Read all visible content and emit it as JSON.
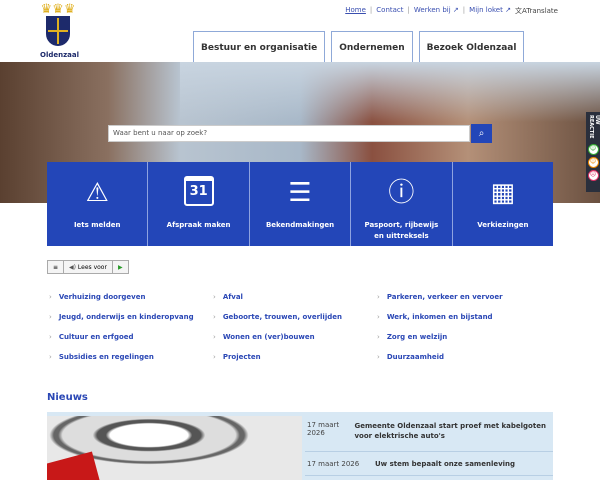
{
  "logo": {
    "name": "Oldenzaal"
  },
  "toplinks": [
    "Home",
    "Contact",
    "Werken bij",
    "Mijn loket",
    "Translate"
  ],
  "nav": [
    "Bestuur en organisatie",
    "Ondernemen",
    "Bezoek Oldenzaal"
  ],
  "search": {
    "placeholder": "Waar bent u naar op zoek?"
  },
  "tiles": [
    "Iets melden",
    "Afspraak maken",
    "Bekendmakingen",
    "Paspoort, rijbewijs en uittreksels",
    "Verkiezingen"
  ],
  "tile_calendar_day": "31",
  "feedback": {
    "label": "UW REACTIE"
  },
  "readspeaker": {
    "label": "Lees voor"
  },
  "links": [
    "Verhuizing doorgeven",
    "Afval",
    "Parkeren, verkeer en vervoer",
    "Jeugd, onderwijs en kinderopvang",
    "Geboorte, trouwen, overlijden",
    "Werk, inkomen en bijstand",
    "Cultuur en erfgoed",
    "Wonen en (ver)bouwen",
    "Zorg en welzijn",
    "Subsidies en regelingen",
    "Projecten",
    "Duurzaamheid"
  ],
  "news": {
    "title": "Nieuws",
    "items": [
      {
        "date": "17 maart 2026",
        "title": "Gemeente Oldenzaal start proef met kabelgoten voor elektrische auto's"
      },
      {
        "date": "17 maart 2026",
        "title": "Uw stem bepaalt onze samenleving"
      }
    ]
  }
}
